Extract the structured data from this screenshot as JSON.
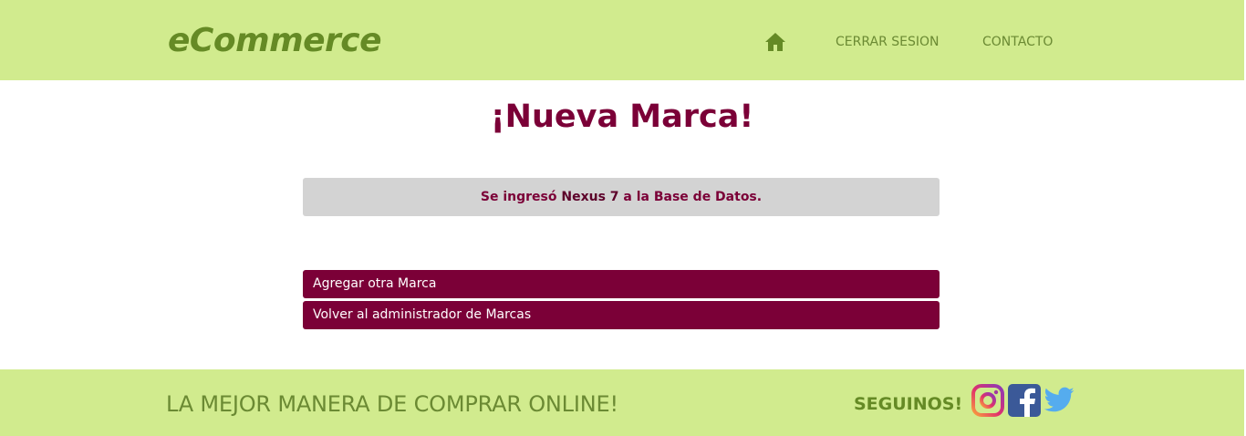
{
  "header": {
    "brand": "eCommerce",
    "nav": {
      "home_icon": "home-icon",
      "logout_label": "CERRAR SESION",
      "contact_label": "CONTACTO"
    }
  },
  "main": {
    "title": "¡Nueva Marca!",
    "alert": {
      "prefix": "Se ingresó ",
      "brand_name": "Nexus 7",
      "suffix": " a la Base de Datos."
    },
    "actions": [
      {
        "label": "Agregar otra Marca"
      },
      {
        "label": "Volver al administrador de Marcas"
      }
    ]
  },
  "footer": {
    "slogan": "LA MEJOR MANERA DE COMPRAR ONLINE!",
    "follow_label": "SEGUINOS!",
    "social": [
      "instagram-icon",
      "facebook-icon",
      "twitter-icon"
    ]
  },
  "colors": {
    "header_bg": "#d1eb8e",
    "accent": "#7b0037",
    "brand_green": "#658a25"
  }
}
